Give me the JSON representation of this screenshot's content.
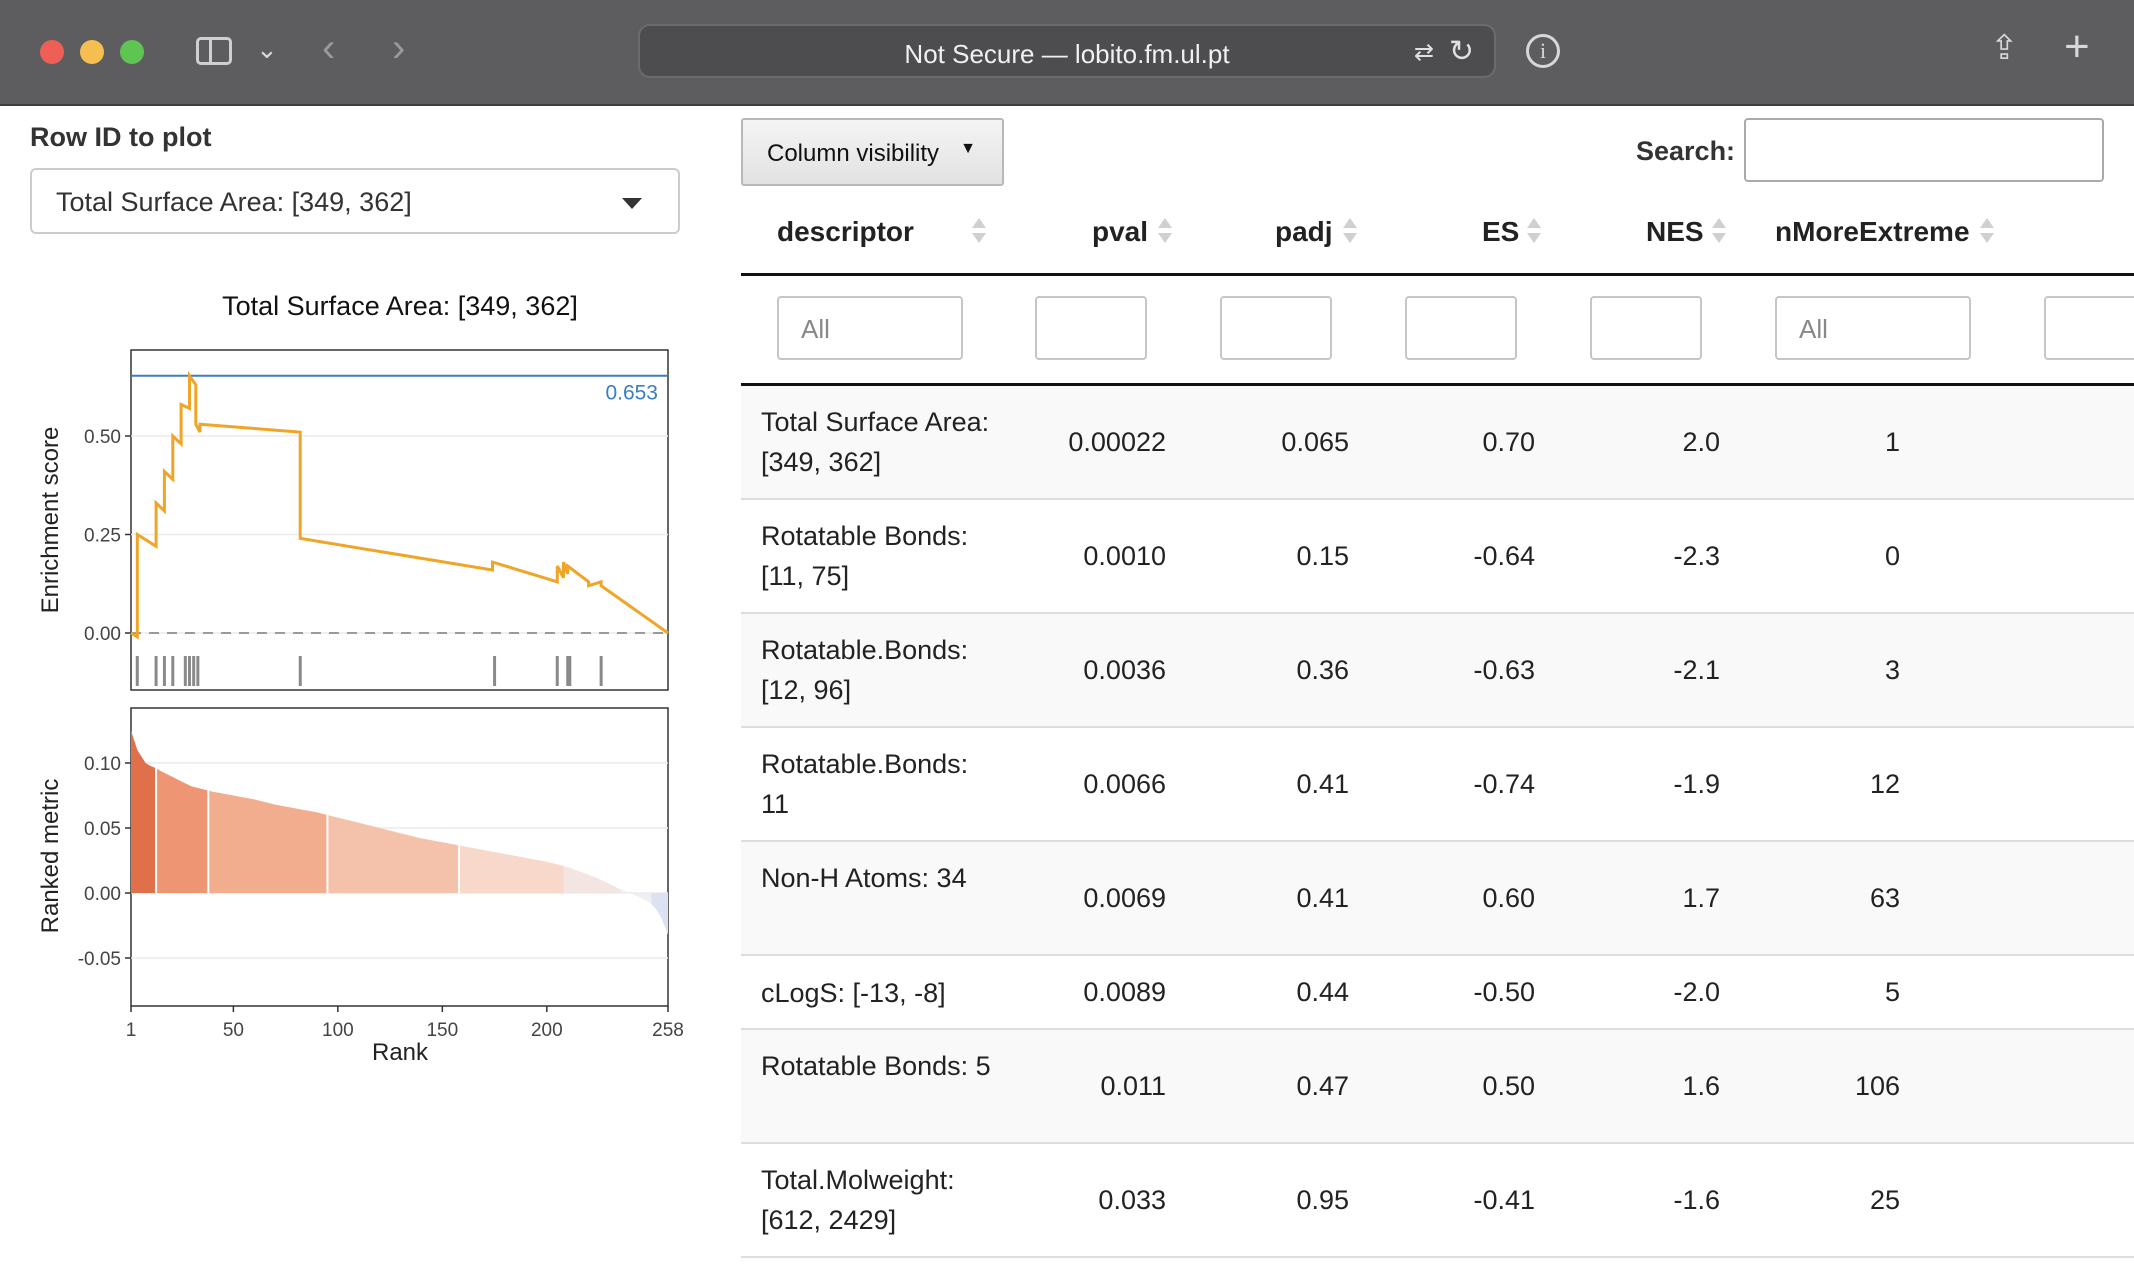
{
  "browser": {
    "url_text": "Not Secure — lobito.fm.ul.pt"
  },
  "left_panel": {
    "row_label": "Row ID to plot",
    "selected_row": "Total Surface Area: [349, 362]"
  },
  "chart_data": [
    {
      "type": "line",
      "title": "Total Surface Area: [349, 362]",
      "xlabel": "",
      "ylabel": "Enrichment score",
      "xlim": [
        1,
        258
      ],
      "ylim": [
        -0.05,
        0.75
      ],
      "yticks": [
        "0.00",
        "0.25",
        "0.50"
      ],
      "max_es_label": "0.653",
      "max_es": 0.653,
      "series": [
        {
          "x": [
            1,
            4,
            4,
            13,
            13,
            17,
            17,
            21,
            21,
            25,
            25,
            29,
            29,
            32,
            32,
            34,
            34,
            82,
            82,
            174,
            174,
            205,
            205,
            208,
            208,
            210,
            210,
            220,
            220,
            226,
            226,
            258
          ],
          "y": [
            0.0,
            -0.01,
            0.25,
            0.22,
            0.33,
            0.31,
            0.41,
            0.39,
            0.5,
            0.48,
            0.58,
            0.57,
            0.653,
            0.63,
            0.53,
            0.51,
            0.53,
            0.51,
            0.24,
            0.16,
            0.18,
            0.13,
            0.17,
            0.14,
            0.18,
            0.15,
            0.17,
            0.13,
            0.12,
            0.13,
            0.12,
            0.0
          ]
        }
      ],
      "hits": [
        4,
        13,
        17,
        21,
        27,
        29,
        31,
        33,
        82,
        175,
        205,
        210,
        211,
        226
      ],
      "colors": {
        "line": "#f0a528",
        "max_line": "#3a7dc2",
        "zero_line": "#9a9a9a",
        "hits": "#8a8a8a"
      }
    },
    {
      "type": "area",
      "xlabel": "Rank",
      "ylabel": "Ranked metric",
      "xlim": [
        1,
        258
      ],
      "ylim": [
        -0.085,
        0.125
      ],
      "yticks": [
        "0.10",
        "0.05",
        "0.00",
        "-0.05"
      ],
      "xticks": [
        "1",
        "50",
        "100",
        "150",
        "200",
        "258"
      ],
      "xtick_values": [
        1,
        50,
        100,
        150,
        200,
        258
      ],
      "curve": {
        "x": [
          1,
          2,
          3,
          4,
          6,
          8,
          10,
          13,
          15,
          20,
          25,
          30,
          35,
          40,
          50,
          60,
          70,
          80,
          90,
          95,
          100,
          110,
          120,
          130,
          140,
          150,
          160,
          170,
          180,
          190,
          200,
          210,
          220,
          225,
          230,
          235,
          240,
          244,
          248,
          251,
          253,
          255,
          257,
          258
        ],
        "y": [
          0.125,
          0.12,
          0.115,
          0.11,
          0.105,
          0.1,
          0.098,
          0.096,
          0.094,
          0.09,
          0.086,
          0.082,
          0.08,
          0.078,
          0.075,
          0.072,
          0.068,
          0.065,
          0.062,
          0.06,
          0.058,
          0.054,
          0.05,
          0.046,
          0.042,
          0.039,
          0.036,
          0.033,
          0.03,
          0.027,
          0.024,
          0.02,
          0.014,
          0.011,
          0.007,
          0.003,
          0.0,
          -0.003,
          -0.006,
          -0.01,
          -0.014,
          -0.02,
          -0.028,
          -0.032
        ]
      },
      "bands": [
        {
          "from": 1,
          "to": 13,
          "color": "#e0704a"
        },
        {
          "from": 13,
          "to": 38,
          "color": "#ee9673"
        },
        {
          "from": 38,
          "to": 95,
          "color": "#f2ad8f"
        },
        {
          "from": 95,
          "to": 158,
          "color": "#f4c1aa"
        },
        {
          "from": 158,
          "to": 208,
          "color": "#f7d8ca"
        },
        {
          "from": 208,
          "to": 235,
          "color": "#f3e6e2"
        },
        {
          "from": 235,
          "to": 250,
          "color": "#eeeef3"
        },
        {
          "from": 250,
          "to": 258,
          "color": "#dde2f3"
        }
      ]
    }
  ],
  "toolbar": {
    "column_visibility_label": "Column visibility",
    "column_visibility_caret": "▼",
    "search_label": "Search:",
    "search_value": ""
  },
  "table": {
    "columns": [
      "descriptor",
      "pval",
      "padj",
      "ES",
      "NES",
      "nMoreExtreme"
    ],
    "filters": [
      "All",
      "",
      "",
      "",
      "",
      "All",
      ""
    ],
    "rows": [
      [
        "Total Surface Area: [349, 362]",
        "0.00022",
        "0.065",
        "0.70",
        "2.0",
        "1"
      ],
      [
        "Rotatable Bonds: [11, 75]",
        "0.0010",
        "0.15",
        "-0.64",
        "-2.3",
        "0"
      ],
      [
        "Rotatable.Bonds: [12, 96]",
        "0.0036",
        "0.36",
        "-0.63",
        "-2.1",
        "3"
      ],
      [
        "Rotatable.Bonds: 11",
        "0.0066",
        "0.41",
        "-0.74",
        "-1.9",
        "12"
      ],
      [
        "Non-H Atoms: 34",
        "0.0069",
        "0.41",
        "0.60",
        "1.7",
        "63"
      ],
      [
        "cLogS: [-13, -8]",
        "0.0089",
        "0.44",
        "-0.50",
        "-2.0",
        "5"
      ],
      [
        "Rotatable Bonds: 5",
        "0.011",
        "0.47",
        "0.50",
        "1.6",
        "106"
      ],
      [
        "Total.Molweight: [612, 2429]",
        "0.033",
        "0.95",
        "-0.41",
        "-1.6",
        "25"
      ]
    ]
  }
}
